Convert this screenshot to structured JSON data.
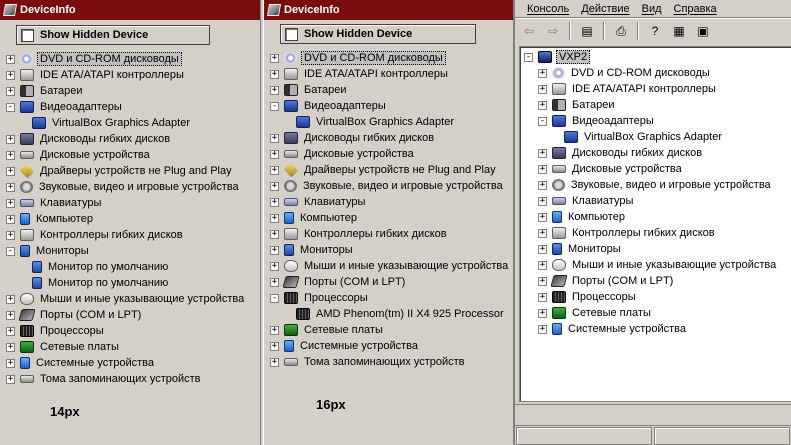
{
  "panel1": {
    "title": "DeviceInfo",
    "show_hidden_label": "Show Hidden Device",
    "size_note": "14px",
    "items": [
      {
        "label": "DVD и CD-ROM дисководы",
        "icon": "cd-rom-icon",
        "expander": "+",
        "selected": true
      },
      {
        "label": "IDE ATA/ATAPI контроллеры",
        "icon": "ide-controller-icon",
        "expander": "+"
      },
      {
        "label": "Батареи",
        "icon": "battery-icon",
        "expander": "+"
      },
      {
        "label": "Видеоадаптеры",
        "icon": "display-adapter-icon",
        "expander": "-"
      },
      {
        "label": "VirtualBox Graphics Adapter",
        "icon": "display-adapter-icon",
        "child": true
      },
      {
        "label": "Дисководы гибких дисков",
        "icon": "floppy-drive-icon",
        "expander": "+"
      },
      {
        "label": "Дисковые устройства",
        "icon": "disk-drive-icon",
        "expander": "+"
      },
      {
        "label": "Драйверы устройств не Plug and Play",
        "icon": "non-pnp-driver-icon",
        "expander": "+"
      },
      {
        "label": "Звуковые, видео и игровые устройства",
        "icon": "sound-icon",
        "expander": "+"
      },
      {
        "label": "Клавиатуры",
        "icon": "keyboard-icon",
        "expander": "+"
      },
      {
        "label": "Компьютер",
        "icon": "computer-icon",
        "expander": "+"
      },
      {
        "label": "Контроллеры гибких дисков",
        "icon": "floppy-controller-icon",
        "expander": "+"
      },
      {
        "label": "Мониторы",
        "icon": "monitor-icon",
        "expander": "-"
      },
      {
        "label": "Монитор по умолчанию",
        "icon": "monitor-icon",
        "child": true
      },
      {
        "label": "Монитор по умолчанию",
        "icon": "monitor-icon",
        "child": true
      },
      {
        "label": "Мыши и иные указывающие устройства",
        "icon": "mouse-icon",
        "expander": "+"
      },
      {
        "label": "Порты (COM и LPT)",
        "icon": "port-icon",
        "expander": "+"
      },
      {
        "label": "Процессоры",
        "icon": "cpu-icon",
        "expander": "+"
      },
      {
        "label": "Сетевые платы",
        "icon": "network-adapter-icon",
        "expander": "+"
      },
      {
        "label": "Системные устройства",
        "icon": "system-device-icon",
        "expander": "+"
      },
      {
        "label": "Тома запоминающих устройств",
        "icon": "storage-volume-icon",
        "expander": "+"
      }
    ]
  },
  "panel2": {
    "title": "DeviceInfo",
    "show_hidden_label": "Show Hidden Device",
    "size_note": "16px",
    "items": [
      {
        "label": "DVD и CD-ROM дисководы",
        "icon": "cd-rom-icon",
        "expander": "+",
        "selected": true
      },
      {
        "label": "IDE ATA/ATAPI контроллеры",
        "icon": "ide-controller-icon",
        "expander": "+"
      },
      {
        "label": "Батареи",
        "icon": "battery-icon",
        "expander": "+"
      },
      {
        "label": "Видеоадаптеры",
        "icon": "display-adapter-icon",
        "expander": "-"
      },
      {
        "label": "VirtualBox Graphics Adapter",
        "icon": "display-adapter-icon",
        "child": true
      },
      {
        "label": "Дисководы гибких дисков",
        "icon": "floppy-drive-icon",
        "expander": "+"
      },
      {
        "label": "Дисковые устройства",
        "icon": "disk-drive-icon",
        "expander": "+"
      },
      {
        "label": "Драйверы устройств не Plug and Play",
        "icon": "non-pnp-driver-icon",
        "expander": "+"
      },
      {
        "label": "Звуковые, видео и игровые устройства",
        "icon": "sound-icon",
        "expander": "+"
      },
      {
        "label": "Клавиатуры",
        "icon": "keyboard-icon",
        "expander": "+"
      },
      {
        "label": "Компьютер",
        "icon": "computer-icon",
        "expander": "+"
      },
      {
        "label": "Контроллеры гибких дисков",
        "icon": "floppy-controller-icon",
        "expander": "+"
      },
      {
        "label": "Мониторы",
        "icon": "monitor-icon",
        "expander": "+"
      },
      {
        "label": "Мыши и иные указывающие устройства",
        "icon": "mouse-icon",
        "expander": "+"
      },
      {
        "label": "Порты (COM и LPT)",
        "icon": "port-icon",
        "expander": "+"
      },
      {
        "label": "Процессоры",
        "icon": "cpu-icon",
        "expander": "-"
      },
      {
        "label": "AMD Phenom(tm) II X4 925 Processor",
        "icon": "cpu-icon",
        "child": true
      },
      {
        "label": "Сетевые платы",
        "icon": "network-adapter-icon",
        "expander": "+"
      },
      {
        "label": "Системные устройства",
        "icon": "system-device-icon",
        "expander": "+"
      },
      {
        "label": "Тома запоминающих устройств",
        "icon": "storage-volume-icon",
        "expander": "+"
      }
    ]
  },
  "panel3": {
    "menu": [
      "Консоль",
      "Действие",
      "Вид",
      "Справка"
    ],
    "toolbar": [
      {
        "icon": "back-arrow-icon",
        "glyph": "⇦",
        "active": false
      },
      {
        "icon": "forward-arrow-icon",
        "glyph": "⇨",
        "active": false
      },
      {
        "icon": "show-hide-tree-icon",
        "glyph": "▤",
        "active": true
      },
      {
        "icon": "print-icon",
        "glyph": "⎙",
        "active": true
      },
      {
        "icon": "help-icon",
        "glyph": "?",
        "active": true
      },
      {
        "icon": "properties-icon",
        "glyph": "▦",
        "active": true
      },
      {
        "icon": "scan-hardware-icon",
        "glyph": "▣",
        "active": true
      }
    ],
    "root_label": "VXP2",
    "items": [
      {
        "label": "DVD и CD-ROM дисководы",
        "icon": "cd-rom-icon",
        "expander": "+"
      },
      {
        "label": "IDE ATA/ATAPI контроллеры",
        "icon": "ide-controller-icon",
        "expander": "+"
      },
      {
        "label": "Батареи",
        "icon": "battery-icon",
        "expander": "+"
      },
      {
        "label": "Видеоадаптеры",
        "icon": "display-adapter-icon",
        "expander": "-"
      },
      {
        "label": "VirtualBox Graphics Adapter",
        "icon": "display-adapter-icon",
        "child": true
      },
      {
        "label": "Дисководы гибких дисков",
        "icon": "floppy-drive-icon",
        "expander": "+"
      },
      {
        "label": "Дисковые устройства",
        "icon": "disk-drive-icon",
        "expander": "+"
      },
      {
        "label": "Звуковые, видео и игровые устройства",
        "icon": "sound-icon",
        "expander": "+"
      },
      {
        "label": "Клавиатуры",
        "icon": "keyboard-icon",
        "expander": "+"
      },
      {
        "label": "Компьютер",
        "icon": "computer-icon",
        "expander": "+"
      },
      {
        "label": "Контроллеры гибких дисков",
        "icon": "floppy-controller-icon",
        "expander": "+"
      },
      {
        "label": "Мониторы",
        "icon": "monitor-icon",
        "expander": "+"
      },
      {
        "label": "Мыши и иные указывающие устройства",
        "icon": "mouse-icon",
        "expander": "+"
      },
      {
        "label": "Порты (COM и LPT)",
        "icon": "port-icon",
        "expander": "+"
      },
      {
        "label": "Процессоры",
        "icon": "cpu-icon",
        "expander": "+"
      },
      {
        "label": "Сетевые платы",
        "icon": "network-adapter-icon",
        "expander": "+"
      },
      {
        "label": "Системные устройства",
        "icon": "system-device-icon",
        "expander": "+"
      }
    ]
  },
  "colors": {
    "titlebar": "#7a0e0e",
    "window_bg": "#d4d0c8",
    "selection": "#c0c0c0"
  }
}
